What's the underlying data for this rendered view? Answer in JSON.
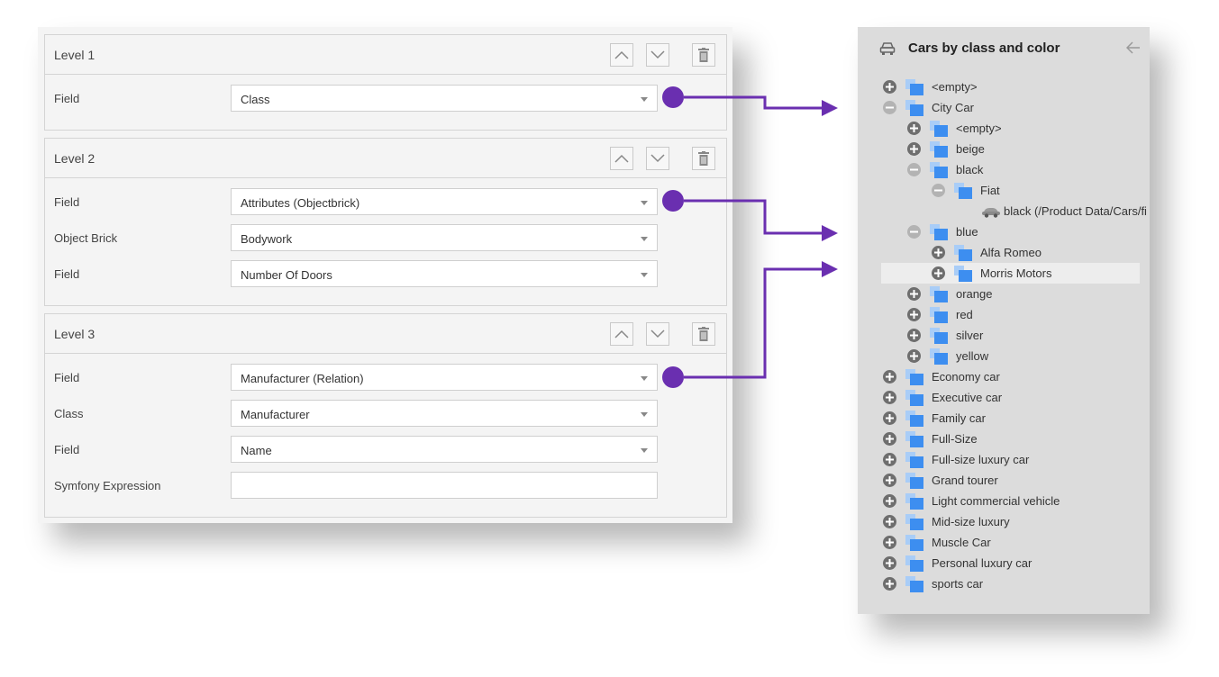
{
  "levels": [
    {
      "title": "Level 1",
      "fields": [
        {
          "label": "Field",
          "value": "Class"
        }
      ]
    },
    {
      "title": "Level 2",
      "fields": [
        {
          "label": "Field",
          "value": "Attributes (Objectbrick)"
        },
        {
          "label": "Object Brick",
          "value": "Bodywork"
        },
        {
          "label": "Field",
          "value": "Number Of Doors"
        }
      ]
    },
    {
      "title": "Level 3",
      "fields": [
        {
          "label": "Field",
          "value": "Manufacturer (Relation)"
        },
        {
          "label": "Class",
          "value": "Manufacturer"
        },
        {
          "label": "Field",
          "value": "Name"
        },
        {
          "label": "Symfony Expression",
          "value": ""
        }
      ]
    }
  ],
  "tree": {
    "title": "Cars by class and color",
    "items": [
      {
        "label": "<empty>",
        "state": "collapsed"
      },
      {
        "label": "City Car",
        "state": "expanded"
      },
      {
        "label": "<empty>",
        "state": "collapsed"
      },
      {
        "label": "beige",
        "state": "collapsed"
      },
      {
        "label": "black",
        "state": "expanded"
      },
      {
        "label": "Fiat",
        "state": "expanded"
      },
      {
        "label": "black (/Product Data/Cars/fi",
        "state": "leaf"
      },
      {
        "label": "blue",
        "state": "expanded"
      },
      {
        "label": "Alfa Romeo",
        "state": "collapsed"
      },
      {
        "label": "Morris Motors",
        "state": "collapsed"
      },
      {
        "label": "orange",
        "state": "collapsed"
      },
      {
        "label": "red",
        "state": "collapsed"
      },
      {
        "label": "silver",
        "state": "collapsed"
      },
      {
        "label": "yellow",
        "state": "collapsed"
      },
      {
        "label": "Economy car",
        "state": "collapsed"
      },
      {
        "label": "Executive car",
        "state": "collapsed"
      },
      {
        "label": "Family car",
        "state": "collapsed"
      },
      {
        "label": "Full-Size",
        "state": "collapsed"
      },
      {
        "label": "Full-size luxury car",
        "state": "collapsed"
      },
      {
        "label": "Grand tourer",
        "state": "collapsed"
      },
      {
        "label": "Light commercial vehicle",
        "state": "collapsed"
      },
      {
        "label": "Mid-size luxury",
        "state": "collapsed"
      },
      {
        "label": "Muscle Car",
        "state": "collapsed"
      },
      {
        "label": "Personal luxury car",
        "state": "collapsed"
      },
      {
        "label": "sports car",
        "state": "collapsed"
      }
    ],
    "selected_label": "Morris Motors"
  },
  "colors": {
    "connector": "#6a2fb0",
    "folder_front": "#3d8ef0",
    "folder_back": "#a9cdf7"
  },
  "icons": {
    "header_icon": "car-icon",
    "collapse_icon": "arrow-left-icon",
    "move_up": "chevron-up-icon",
    "move_down": "chevron-down-icon",
    "delete": "trash-icon",
    "leaf_icon": "car-icon"
  }
}
